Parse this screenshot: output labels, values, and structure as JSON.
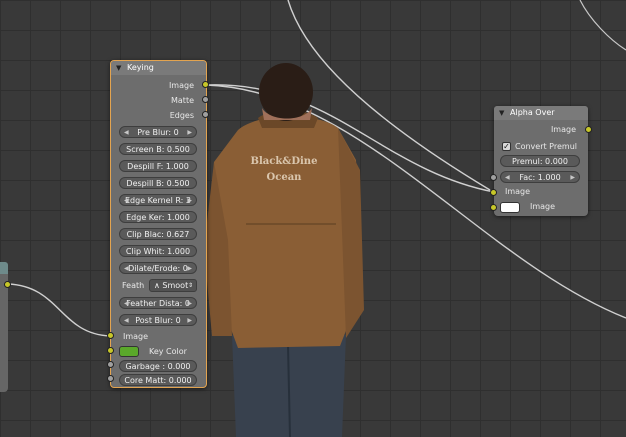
{
  "keying_node": {
    "title": "Keying",
    "outputs": [
      "Image",
      "Matte",
      "Edges"
    ],
    "fields": [
      "Pre Blur: 0",
      "Screen B: 0.500",
      "Despill F: 1.000",
      "Despill B: 0.500",
      "Edge Kernel R: 3",
      "Edge Ker: 1.000",
      "Clip Blac: 0.627",
      "Clip Whit: 1.000",
      "Dilate/Erode: 0"
    ],
    "feather_label": "Feath",
    "feather_mode": "Smoot",
    "fields2": [
      "Feather Dista: 0",
      "Post Blur: 0"
    ],
    "inputs": {
      "image": "Image",
      "key_color": "Key Color",
      "garbage": "Garbage : 0.000",
      "core_matte": "Core Matt: 0.000"
    },
    "key_color_hex": "#5aa82a"
  },
  "alpha_over_node": {
    "title": "Alpha Over",
    "output": "Image",
    "convert_premul_label": "Convert Premul",
    "convert_premul_checked": true,
    "premul": "Premul: 0.000",
    "fac": "Fac: 1.000",
    "input_image_1": "Image",
    "input_image_2": "Image",
    "image_2_color_hex": "#ffffff"
  },
  "shirt_print": "Black&Dine Ocean",
  "colors": {
    "background": "#393939",
    "node_body": "#6d6d6d",
    "selected_border": "#e3a450",
    "socket_yellow": "#c7c729",
    "socket_gray": "#a0a0a0"
  }
}
